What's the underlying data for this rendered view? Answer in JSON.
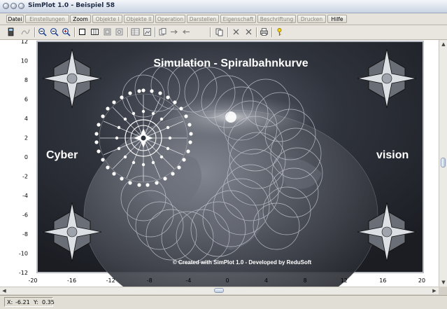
{
  "window": {
    "title": "SimPlot 1.0 - Beispiel 58"
  },
  "menu": [
    {
      "label": "Datei",
      "enabled": true
    },
    {
      "label": "Einstellungen",
      "enabled": false
    },
    {
      "label": "Zoom",
      "enabled": true
    },
    {
      "label": "Objekte I",
      "enabled": false
    },
    {
      "label": "Objekte II",
      "enabled": false
    },
    {
      "label": "Operation",
      "enabled": false
    },
    {
      "label": "Darstellen",
      "enabled": false
    },
    {
      "label": "Eigenschaft",
      "enabled": false
    },
    {
      "label": "Beschriftung",
      "enabled": false
    },
    {
      "label": "Drucken",
      "enabled": false
    },
    {
      "label": "Hilfe",
      "enabled": true
    }
  ],
  "toolbar": {
    "icons": [
      "calculator-icon",
      "curve-icon",
      "zoom-out-icon",
      "zoom-in-icon",
      "zoom-plus-icon",
      "square-icon",
      "grid-dots-icon",
      "grid-box-icon",
      "grid-box-2-icon",
      "table-icon",
      "image-frame-icon",
      "paste-icon",
      "arrow-right-icon",
      "arrow-left-icon",
      "copy-icon",
      "cross-icon",
      "cross-2-icon",
      "printer-icon",
      "help-key-icon"
    ]
  },
  "plot": {
    "x_ticks": [
      "-20",
      "-16",
      "-12",
      "-8",
      "-4",
      "0",
      "4",
      "8",
      "12",
      "16",
      "20"
    ],
    "y_ticks": [
      "12",
      "10",
      "8",
      "6",
      "4",
      "2",
      "0",
      "-2",
      "-4",
      "-6",
      "-8",
      "-10",
      "-12"
    ],
    "xlim": [
      -20,
      20
    ],
    "ylim": [
      -12,
      12
    ],
    "banner": {
      "title": "Simulation - Spiralbahnkurve",
      "left_word": "Cyber",
      "right_word": "vision",
      "credit": "© Created with SimPlot 1.0 - Developed by ReduSoft"
    }
  },
  "status": {
    "x_label": "X:",
    "x_value": "-6.21",
    "y_label": "Y:",
    "y_value": "0.35"
  },
  "colors": {
    "banner_bg": "#2b2f38",
    "banner_border": "#b9bcc3",
    "title_accent": "#1c2a44"
  }
}
